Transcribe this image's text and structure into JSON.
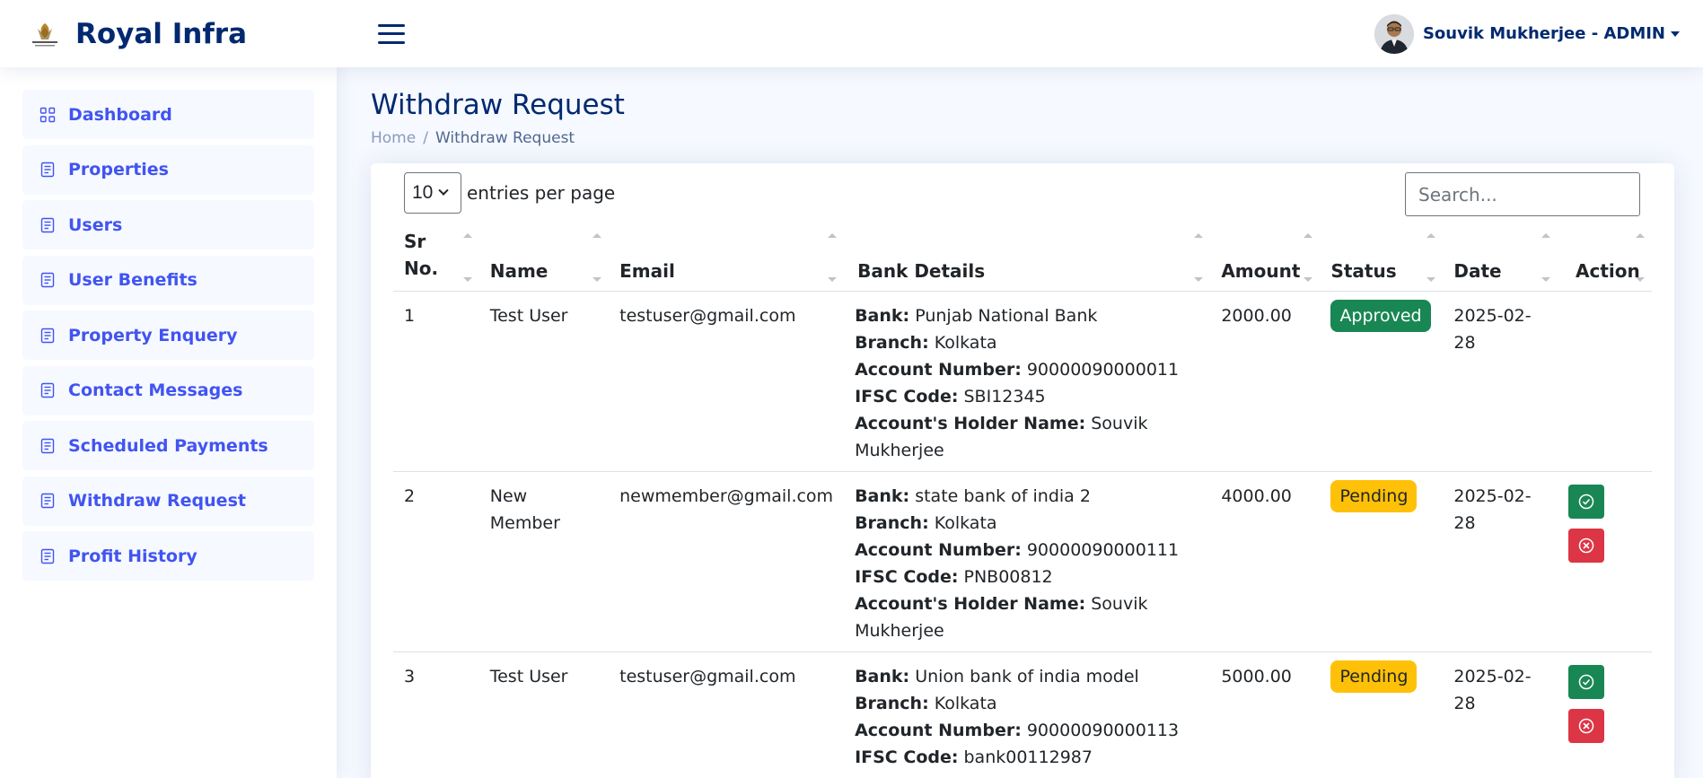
{
  "header": {
    "brand": "Royal Infra",
    "user": "Souvik Mukherjee - ADMIN"
  },
  "sidebar": {
    "items": [
      {
        "label": "Dashboard",
        "icon": "grid-icon"
      },
      {
        "label": "Properties",
        "icon": "document-icon"
      },
      {
        "label": "Users",
        "icon": "document-icon"
      },
      {
        "label": "User Benefits",
        "icon": "document-icon"
      },
      {
        "label": "Property Enquery",
        "icon": "document-icon"
      },
      {
        "label": "Contact Messages",
        "icon": "document-icon"
      },
      {
        "label": "Scheduled Payments",
        "icon": "document-icon"
      },
      {
        "label": "Withdraw Request",
        "icon": "document-icon"
      },
      {
        "label": "Profit History",
        "icon": "document-icon"
      }
    ]
  },
  "page": {
    "title": "Withdraw Request",
    "breadcrumb_home": "Home",
    "breadcrumb_sep": "/",
    "breadcrumb_current": "Withdraw Request"
  },
  "table_controls": {
    "per_page": "10",
    "per_page_label": "entries per page",
    "search_placeholder": "Search..."
  },
  "table": {
    "columns": [
      "Sr No.",
      "Name",
      "Email",
      "Bank Details",
      "Amount",
      "Status",
      "Date",
      "Action"
    ],
    "bank_labels": {
      "bank": "Bank:",
      "branch": "Branch:",
      "account": "Account Number:",
      "ifsc": "IFSC Code:",
      "holder": "Account's Holder Name:"
    },
    "rows": [
      {
        "sr": "1",
        "name": "Test User",
        "email": "testuser@gmail.com",
        "bank": "Punjab National Bank",
        "branch": "Kolkata",
        "account": "90000090000011",
        "ifsc": "SBI12345",
        "holder": "Souvik Mukherjee",
        "amount": "2000.00",
        "status": "Approved",
        "date": "2025-02-28"
      },
      {
        "sr": "2",
        "name": "New Member",
        "email": "newmember@gmail.com",
        "bank": "state bank of india 2",
        "branch": "Kolkata",
        "account": "90000090000111",
        "ifsc": "PNB00812",
        "holder": "Souvik Mukherjee",
        "amount": "4000.00",
        "status": "Pending",
        "date": "2025-02-28"
      },
      {
        "sr": "3",
        "name": "Test User",
        "email": "testuser@gmail.com",
        "bank": "Union bank of india model",
        "branch": "Kolkata",
        "account": "90000090000113",
        "ifsc": "bank00112987",
        "holder": "",
        "amount": "5000.00",
        "status": "Pending",
        "date": "2025-02-28"
      }
    ]
  },
  "colors": {
    "brand": "#012970",
    "accent": "#4154f1",
    "approved": "#198754",
    "pending": "#ffc107",
    "reject": "#dc3545"
  }
}
